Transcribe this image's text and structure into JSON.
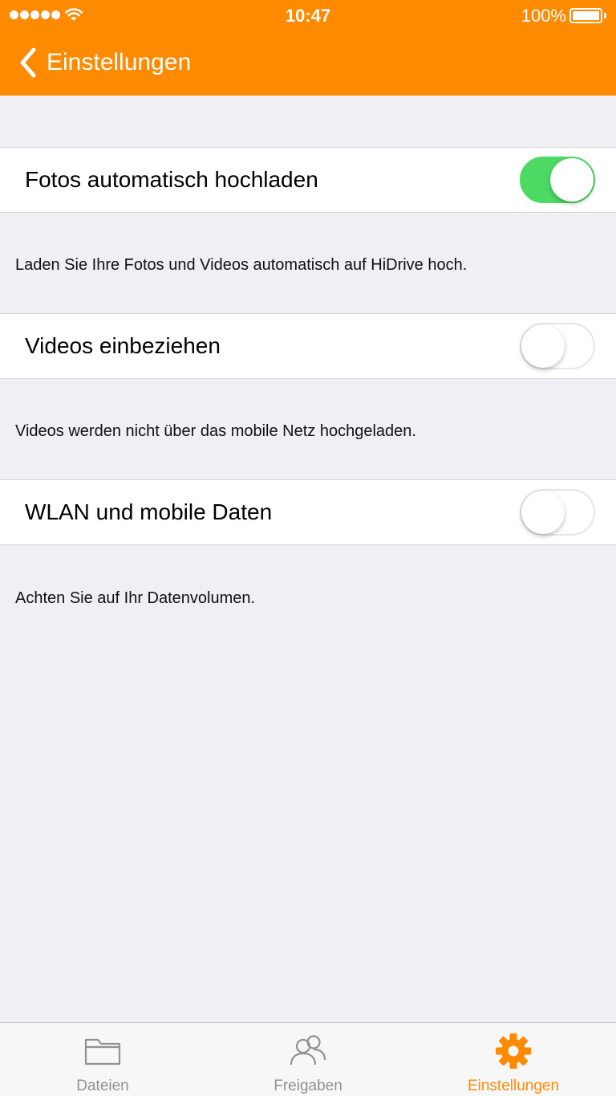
{
  "status_bar": {
    "time": "10:47",
    "battery": "100%",
    "signal_bars": 5
  },
  "nav": {
    "back_label": "Einstellungen"
  },
  "settings": [
    {
      "label": "Fotos automatisch hochladen",
      "on": true,
      "footnote": "Laden Sie Ihre Fotos und Videos automatisch auf HiDrive hoch."
    },
    {
      "label": "Videos einbeziehen",
      "on": false,
      "footnote": "Videos werden nicht über das mobile Netz hochgeladen."
    },
    {
      "label": "WLAN und mobile Daten",
      "on": false,
      "footnote": "Achten Sie auf Ihr Datenvolumen."
    }
  ],
  "tabbar": {
    "tabs": [
      {
        "label": "Dateien",
        "icon": "folder-icon",
        "active": false
      },
      {
        "label": "Freigaben",
        "icon": "people-icon",
        "active": false
      },
      {
        "label": "Einstellungen",
        "icon": "gear-icon",
        "active": true
      }
    ]
  },
  "colors": {
    "accent": "#fe8a00",
    "toggle_on": "#4cd964",
    "background": "#efeff4"
  }
}
